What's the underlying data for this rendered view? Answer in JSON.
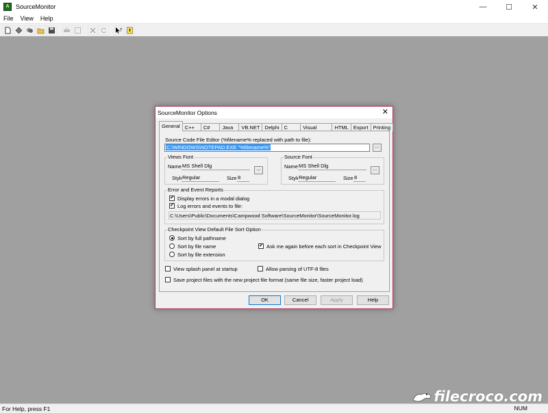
{
  "window": {
    "title": "SourceMonitor",
    "icon_text": "A",
    "controls": {
      "minimize": "—",
      "maximize": "☐",
      "close": "✕"
    }
  },
  "menu": [
    "File",
    "View",
    "Help"
  ],
  "toolbar": {
    "buttons": [
      "new-icon",
      "open-project-icon",
      "checkpoint-icon",
      "open-folder-icon",
      "save-icon",
      "print-icon",
      "view-icon",
      "delete-icon",
      "refresh-icon",
      "context-help-icon",
      "about-icon"
    ]
  },
  "statusbar": {
    "help": "For Help, press F1",
    "right": "NUM"
  },
  "watermark": {
    "text": "filecroco.com"
  },
  "dialog": {
    "title": "SourceMonitor Options",
    "close": "✕",
    "tabs": [
      "General",
      "C++",
      "C#",
      "Java",
      "VB.NET",
      "Delphi",
      "C",
      "Visual Basic",
      "HTML",
      "Export",
      "Printing"
    ],
    "active_tab": "General",
    "editor_label": "Source Code File Editor (%filename% replaced with path to file):",
    "editor_value": "C:\\WINDOWS\\NOTEPAD.EXE \"%filename%\"",
    "browse": "...",
    "views_font": {
      "title": "Views Font",
      "name_label": "Name",
      "name_value": "MS Shell Dlg",
      "style_label": "Style",
      "style_value": "Regular",
      "size_label": "Size",
      "size_value": "8"
    },
    "source_font": {
      "title": "Source Font",
      "name_label": "Name",
      "name_value": "MS Shell Dlg",
      "style_label": "Style",
      "style_value": "Regular",
      "size_label": "Size",
      "size_value": "8"
    },
    "errors": {
      "title": "Error and Event Reports",
      "display_modal": "Display errors in a modal dialog",
      "display_modal_checked": true,
      "log_errors": "Log errors and events to file:",
      "log_errors_checked": true,
      "log_path": "C:\\Users\\Public\\Documents\\Campwood Software\\SourceMonitor\\SourceMonitor.log"
    },
    "checkpoint": {
      "title": "Checkpoint View Default File Sort Option",
      "sort_pathname": "Sort by full pathname",
      "sort_filename": "Sort by file name",
      "sort_extension": "Sort by file extension",
      "selected": "Sort by full pathname",
      "ask_again": "Ask me again before each sort in Checkpoint View",
      "ask_again_checked": true
    },
    "splash": "View splash panel at startup",
    "splash_checked": false,
    "utf8": "Allow parsing of UTF-8 files",
    "utf8_checked": false,
    "save_format": "Save project files with the new project file format (same file size, faster project load)",
    "save_format_checked": false,
    "buttons": {
      "ok": "OK",
      "cancel": "Cancel",
      "apply": "Apply",
      "help": "Help"
    }
  }
}
